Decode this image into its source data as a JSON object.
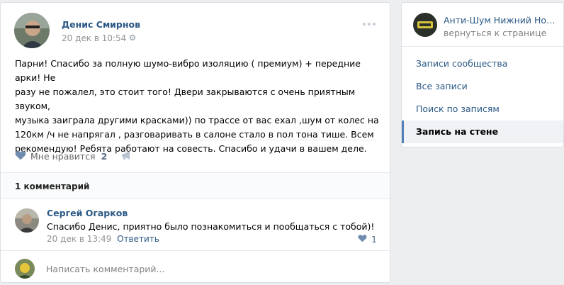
{
  "post": {
    "author": "Денис Смирнов",
    "date": "20 дек в 10:54",
    "text_lines": [
      "Парни! Спасибо за полную шумо-вибро изоляцию ( премиум) + передние арки! Не",
      "разу не пожалел, это стоит того! Двери закрываются с очень приятным звуком,",
      "музыка заиграла другими красками)) по трассе от вас ехал ,шум от колес на",
      "120км /ч не напрягал , разговаривать в салоне стало в пол тона тише. Всем",
      "рекомендую! Ребята работают на совесть. Спасибо и удачи в вашем деле."
    ],
    "like_label": "Мне нравится",
    "like_count": "2"
  },
  "comments": {
    "count_label": "1 комментарий",
    "items": [
      {
        "author": "Сергей Огарков",
        "text": "Спасибо Денис, приятно было познакомиться и пообщаться с тобой)!",
        "date": "20 дек в 13:49",
        "reply_label": "Ответить",
        "likes": "1"
      }
    ],
    "input_placeholder": "Написать комментарий..."
  },
  "sidebar": {
    "group_name": "Анти-Шум Нижний Новгород",
    "back_label": "вернуться к странице",
    "menu": [
      {
        "label": "Записи сообщества",
        "active": false
      },
      {
        "label": "Все записи",
        "active": false
      },
      {
        "label": "Поиск по записям",
        "active": false
      },
      {
        "label": "Запись на стене",
        "active": true
      }
    ]
  },
  "colors": {
    "background": "#edeef0",
    "link": "#2a5885",
    "accent": "#5181b8",
    "muted": "#939393"
  }
}
